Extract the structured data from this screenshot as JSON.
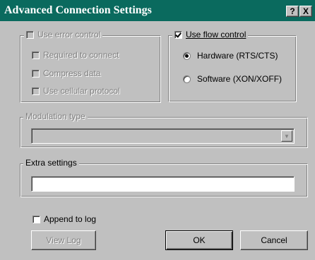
{
  "window": {
    "title": "Advanced Connection Settings",
    "help_label": "?",
    "close_label": "X"
  },
  "error_control": {
    "label": "Use error control",
    "checked": false,
    "enabled": false,
    "options": [
      {
        "label": "Required to connect",
        "checked": false
      },
      {
        "label": "Compress data",
        "checked": false
      },
      {
        "label": "Use cellular protocol",
        "checked": false
      }
    ]
  },
  "flow_control": {
    "label": "Use flow control",
    "checked": true,
    "options": [
      {
        "label": "Hardware (RTS/CTS)",
        "selected": true
      },
      {
        "label": "Software (XON/XOFF)",
        "selected": false
      }
    ]
  },
  "modulation": {
    "label": "Modulation type",
    "value": "",
    "enabled": false
  },
  "extra_settings": {
    "label": "Extra settings",
    "value": ""
  },
  "append_log": {
    "label": "Append to log",
    "checked": false
  },
  "buttons": {
    "view_log": "View Log",
    "ok": "OK",
    "cancel": "Cancel"
  }
}
